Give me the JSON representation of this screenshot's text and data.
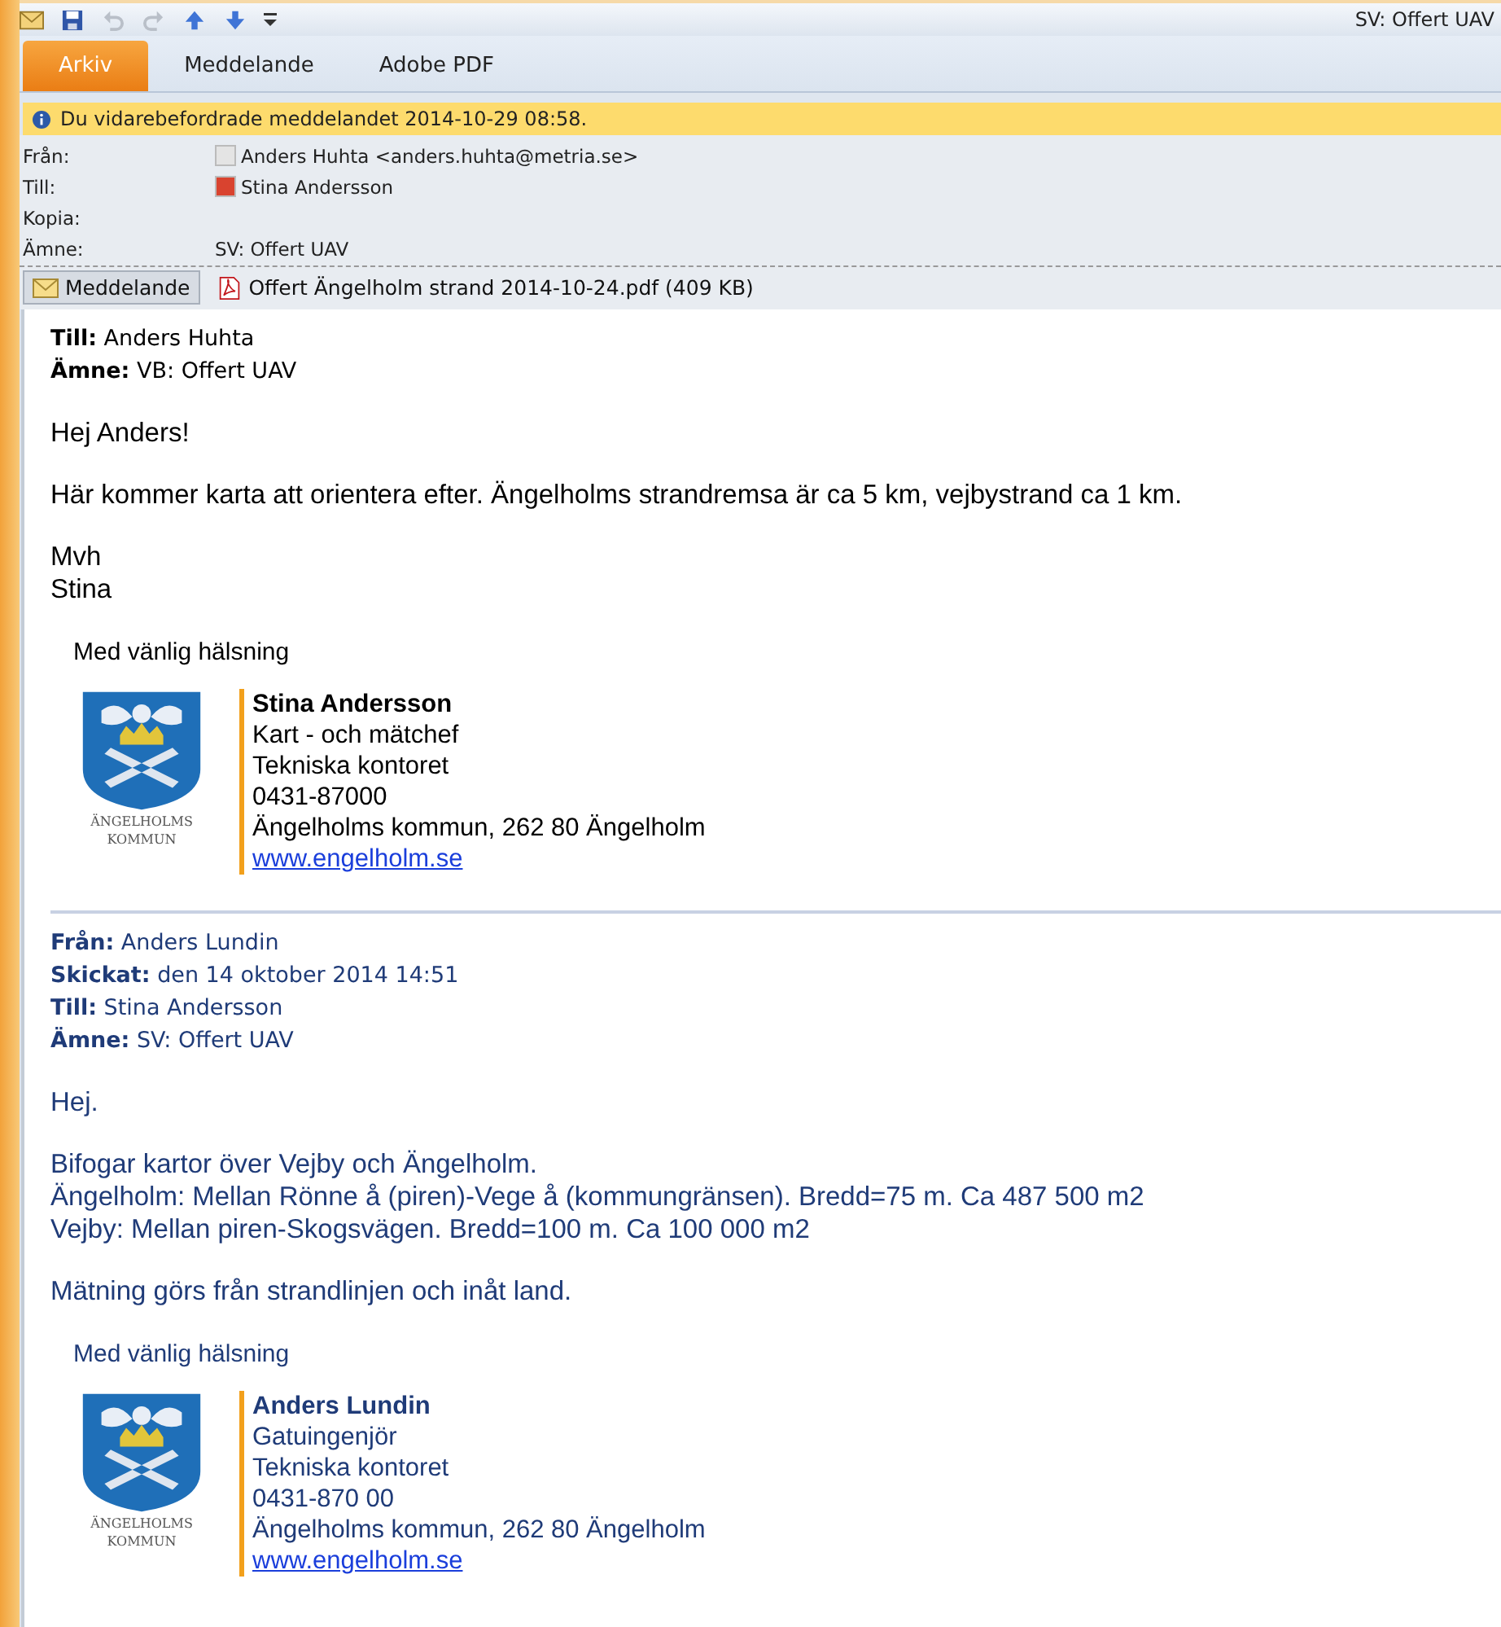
{
  "title_bar": {
    "title": "SV: Offert UAV"
  },
  "ribbon_tabs": [
    {
      "label": "Arkiv",
      "selected": true
    },
    {
      "label": "Meddelande",
      "selected": false
    },
    {
      "label": "Adobe PDF",
      "selected": false
    }
  ],
  "info_bar": {
    "text": "Du vidarebefordrade meddelandet 2014-10-29 08:58."
  },
  "header_fields": [
    {
      "label": "Från:",
      "value": "Anders Huhta <anders.huhta@metria.se>",
      "color": "#e4e4e4"
    },
    {
      "label": "Till:",
      "value": "Stina Andersson",
      "color": "#d9432f"
    },
    {
      "label": "Kopia:"
    },
    {
      "label": "Ämne:",
      "value": "SV: Offert UAV"
    }
  ],
  "attachments": [
    {
      "kind": "message",
      "label": "Meddelande",
      "selected": true
    },
    {
      "kind": "pdf",
      "label": "Offert Ängelholm strand 2014-10-24.pdf (409 KB)",
      "selected": false
    }
  ],
  "messages": [
    {
      "divider": false,
      "color": "#000000",
      "fields": [
        {
          "label": "Till:",
          "value": "Anders Huhta"
        },
        {
          "label": "Ämne:",
          "value": "VB: Offert UAV"
        }
      ],
      "paragraphs": [
        [
          "Hej Anders!"
        ],
        [
          "Här kommer karta att orientera efter. Ängelholms strandremsa är ca 5 km, vejbystrand ca 1 km."
        ],
        [
          "Mvh",
          "Stina"
        ]
      ],
      "signature": {
        "closing": "Med vänlig hälsning",
        "logo_lines": [
          "ÄNGELHOLMS",
          "KOMMUN"
        ],
        "name": "Stina Andersson",
        "lines": [
          "Kart - och mätchef",
          "Tekniska kontoret",
          "0431-87000",
          "Ängelholms kommun, 262 80 Ängelholm"
        ],
        "link": "www.engelholm.se"
      }
    },
    {
      "divider": true,
      "color": "#1f3b78",
      "fields": [
        {
          "label": "Från:",
          "value": "Anders Lundin"
        },
        {
          "label": "Skickat:",
          "value": "den 14 oktober 2014 14:51"
        },
        {
          "label": "Till:",
          "value": "Stina Andersson"
        },
        {
          "label": "Ämne:",
          "value": "SV: Offert UAV"
        }
      ],
      "paragraphs": [
        [
          "Hej."
        ],
        [
          "Bifogar kartor över Vejby och Ängelholm.",
          "Ängelholm: Mellan Rönne å (piren)-Vege å (kommungränsen). Bredd=75 m. Ca 487 500 m2",
          "Vejby: Mellan piren-Skogsvägen. Bredd=100 m. Ca 100 000 m2"
        ],
        [
          "Mätning görs från strandlinjen och inåt land."
        ]
      ],
      "signature": {
        "closing": "Med vänlig hälsning",
        "logo_lines": [
          "ÄNGELHOLMS",
          "KOMMUN"
        ],
        "name": "Anders Lundin",
        "lines": [
          "Gatuingenjör",
          "Tekniska kontoret",
          "0431-870 00",
          "Ängelholms kommun, 262 80 Ängelholm"
        ],
        "link": "www.engelholm.se"
      }
    }
  ]
}
